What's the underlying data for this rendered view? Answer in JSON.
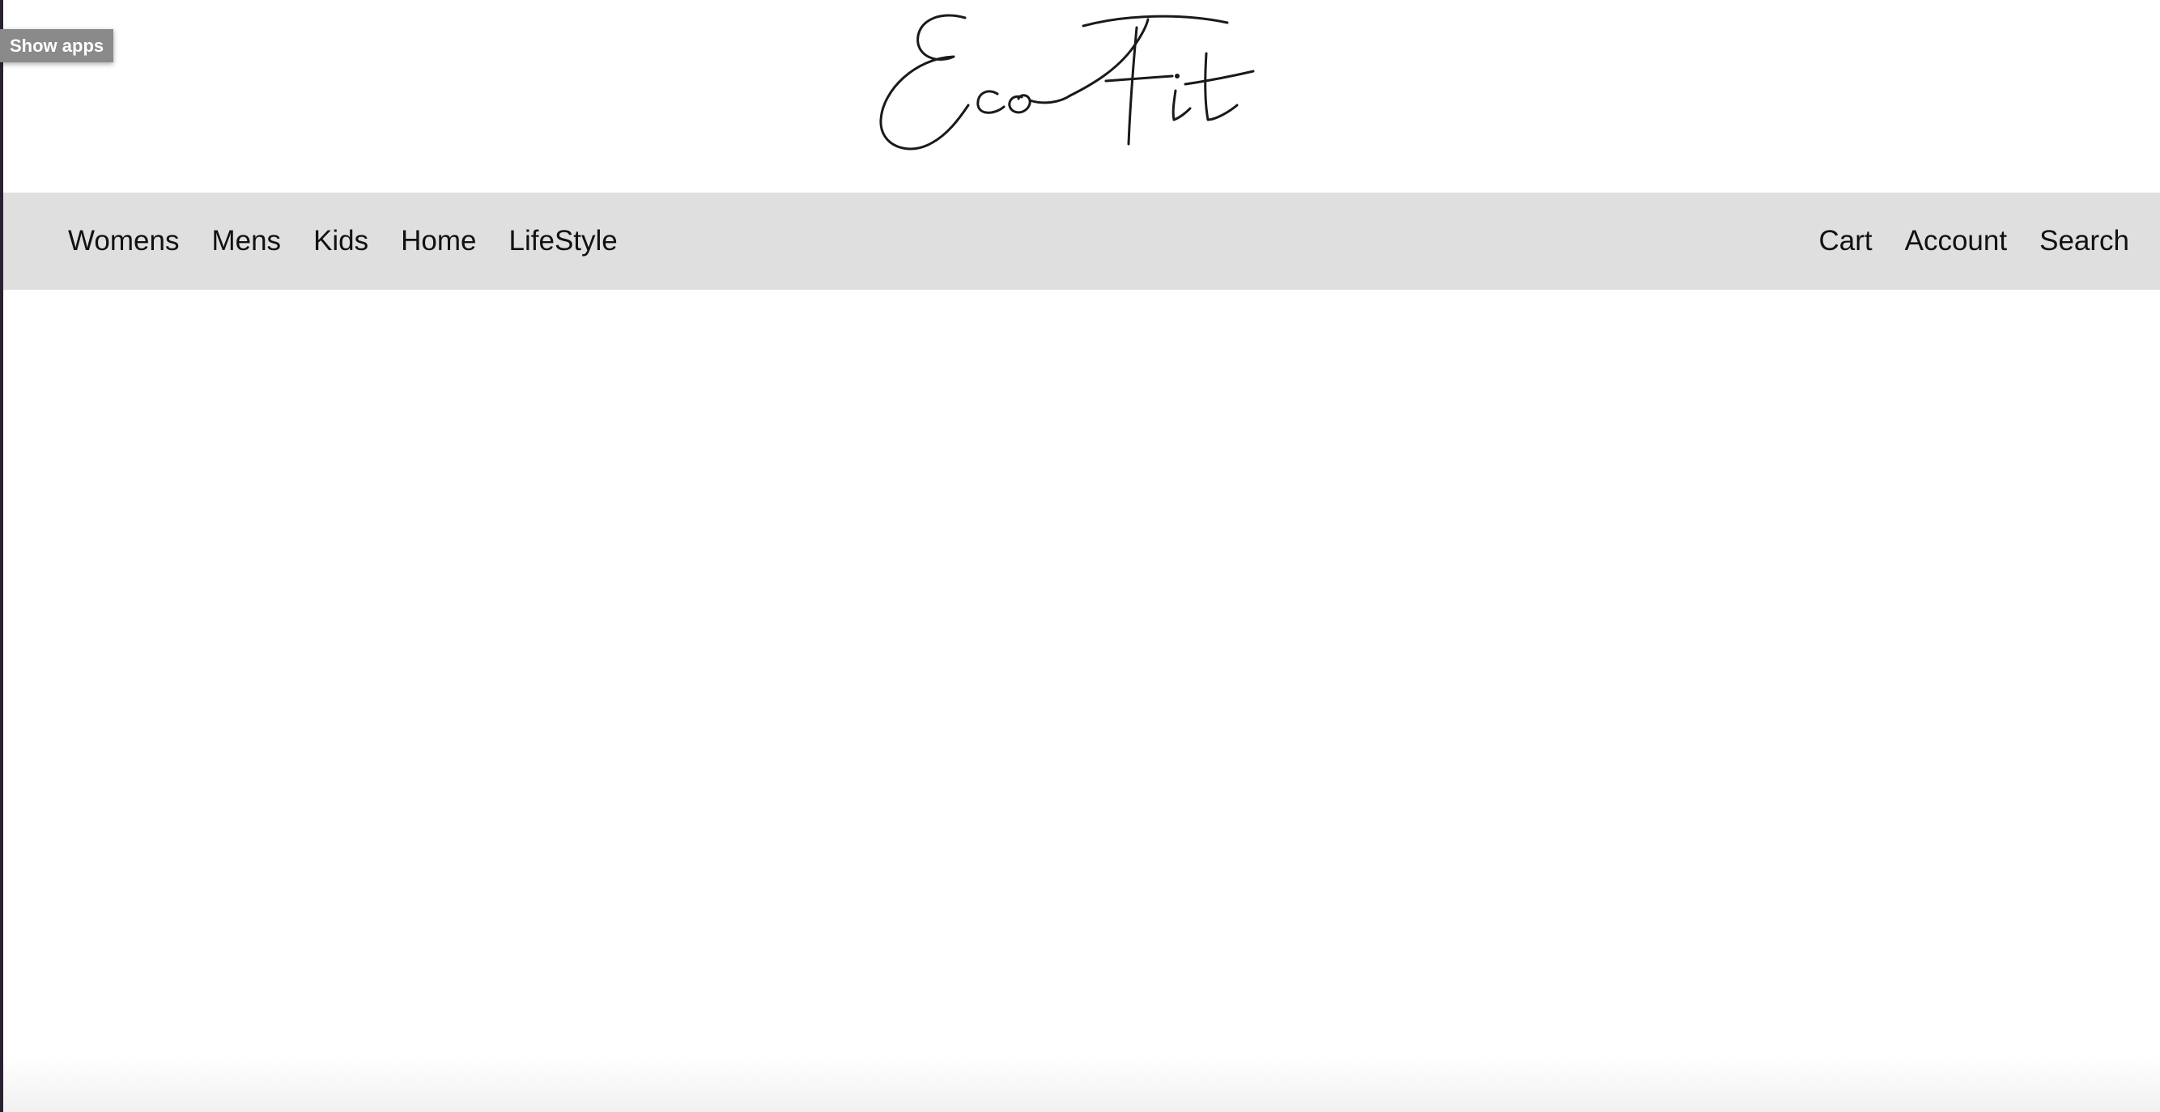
{
  "system": {
    "show_apps_label": "Show apps"
  },
  "header": {
    "logo_text": "EcoFit"
  },
  "nav": {
    "left_links": [
      {
        "label": "Womens"
      },
      {
        "label": "Mens"
      },
      {
        "label": "Kids"
      },
      {
        "label": "Home"
      },
      {
        "label": "LifeStyle"
      }
    ],
    "right_links": [
      {
        "label": "Cart"
      },
      {
        "label": "Account"
      },
      {
        "label": "Search"
      }
    ]
  },
  "colors": {
    "nav_background": "#e0dfe0",
    "nav_text": "#111111",
    "page_background": "#ffffff",
    "show_apps_background": "#8a8a8a"
  }
}
